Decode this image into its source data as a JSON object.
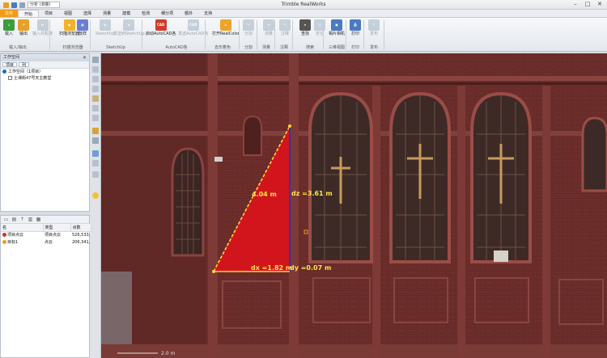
{
  "window": {
    "title": "Trimble RealWorks",
    "qat_select": "分析 (测量)",
    "minimize": "–",
    "maximize": "□",
    "close": "✕"
  },
  "tabs": [
    "文件",
    "开始",
    "项目",
    "视图",
    "选择",
    "测量",
    "建模",
    "检测",
    "细分项",
    "额外",
    "支持"
  ],
  "active_tab_index": 1,
  "ribbon": {
    "buttons": [
      {
        "label": "载入",
        "color": "#3b9d3b",
        "glyph": "↓",
        "enabled": true
      },
      {
        "label": "输出",
        "color": "#e7a12a",
        "glyph": "↗",
        "enabled": true
      },
      {
        "label": "输入并配准",
        "color": "#8fa4b8",
        "glyph": "⇄",
        "enabled": false
      },
      {
        "label": "扫描浏览器",
        "color": "#f0b32c",
        "glyph": "◉",
        "enabled": true
      },
      {
        "label": "放样",
        "color": "#6a7fd1",
        "glyph": "▦",
        "enabled": true
      },
      {
        "label": "SketchUp",
        "color": "#8fa4b8",
        "glyph": "◈",
        "enabled": false
      },
      {
        "label": "发送到SketchUp",
        "color": "#8fa4b8",
        "glyph": "◈",
        "enabled": false
      },
      {
        "label": "启动AutoCAD各",
        "color": "#d13b2a",
        "glyph": "CAD",
        "enabled": true
      },
      {
        "label": "发送AutoCAD各",
        "color": "#8fa4b8",
        "glyph": "CAD",
        "enabled": false
      },
      {
        "label": "打开RealColor",
        "color": "#f0a32a",
        "glyph": "⌂",
        "enabled": true
      },
      {
        "label": "分割",
        "color": "#8fa4b8",
        "glyph": "✂",
        "enabled": false
      },
      {
        "label": "测量",
        "color": "#8fa4b8",
        "glyph": "↔",
        "enabled": false
      },
      {
        "label": "注释",
        "color": "#8fa4b8",
        "glyph": "✎",
        "enabled": false
      },
      {
        "label": "查找",
        "color": "#555555",
        "glyph": "⌕",
        "enabled": true
      },
      {
        "label": "定位",
        "color": "#8fa4b8",
        "glyph": "◎",
        "enabled": false
      },
      {
        "label": "相片相机",
        "color": "#4a7bc0",
        "glyph": "▣",
        "enabled": true
      },
      {
        "label": "打印",
        "color": "#4a7bc0",
        "glyph": "⎙",
        "enabled": true
      },
      {
        "label": "发布",
        "color": "#8fa4b8",
        "glyph": "⇪",
        "enabled": false
      }
    ],
    "groups": [
      "载入/输出",
      "扫描浏览器",
      "SketchUp",
      "AutoCAD各",
      "去形着色",
      "分割",
      "测量",
      "注释",
      "搜索",
      "三维视图",
      "打印",
      "发布"
    ]
  },
  "workspace_panel": {
    "title": "工作空间",
    "pin": "✕",
    "subtabs": [
      "项目",
      "列"
    ],
    "root": "工作空间（1项目）",
    "child": "士课街47号天主教堂"
  },
  "project_panel": {
    "columns": [
      "名",
      "类型",
      "点数"
    ],
    "rows": [
      {
        "name": "项目点云",
        "type": "项目点云",
        "points": "526,533,",
        "icon_color": "#c0392b"
      },
      {
        "name": "目标1",
        "type": "点云",
        "points": "206,341,",
        "icon_color": "#e0a21f"
      }
    ]
  },
  "measurement": {
    "distance_label": "4.04 m",
    "dz_label": "dz =3.61 m",
    "dx_label": "dx =1.82 m",
    "dy_label": "dy =0.07 m",
    "label_color": "#ffe34a",
    "triangle_color": "#e0121b"
  },
  "viewport": {
    "scale_text": "2.0 m"
  }
}
